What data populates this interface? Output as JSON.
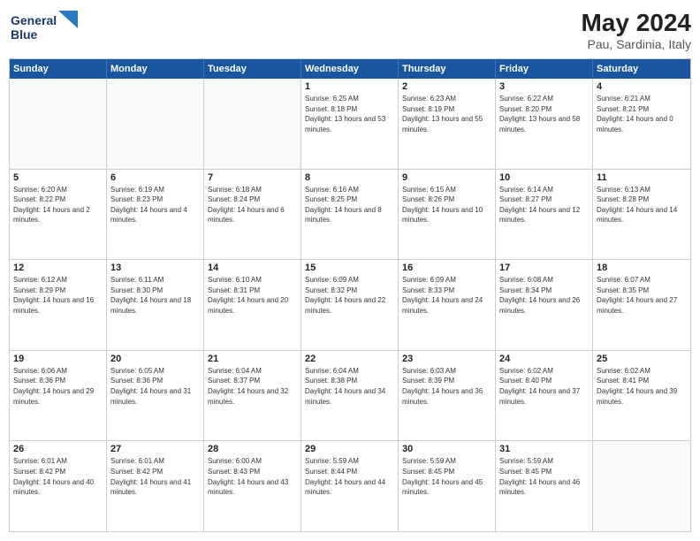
{
  "header": {
    "logo_line1": "General",
    "logo_line2": "Blue",
    "month_title": "May 2024",
    "location": "Pau, Sardinia, Italy"
  },
  "weekdays": [
    "Sunday",
    "Monday",
    "Tuesday",
    "Wednesday",
    "Thursday",
    "Friday",
    "Saturday"
  ],
  "weeks": [
    [
      {
        "day": "",
        "empty": true
      },
      {
        "day": "",
        "empty": true
      },
      {
        "day": "",
        "empty": true
      },
      {
        "day": "1",
        "sunrise": "Sunrise: 6:25 AM",
        "sunset": "Sunset: 8:18 PM",
        "daylight": "Daylight: 13 hours and 53 minutes."
      },
      {
        "day": "2",
        "sunrise": "Sunrise: 6:23 AM",
        "sunset": "Sunset: 8:19 PM",
        "daylight": "Daylight: 13 hours and 55 minutes."
      },
      {
        "day": "3",
        "sunrise": "Sunrise: 6:22 AM",
        "sunset": "Sunset: 8:20 PM",
        "daylight": "Daylight: 13 hours and 58 minutes."
      },
      {
        "day": "4",
        "sunrise": "Sunrise: 6:21 AM",
        "sunset": "Sunset: 8:21 PM",
        "daylight": "Daylight: 14 hours and 0 minutes."
      }
    ],
    [
      {
        "day": "5",
        "sunrise": "Sunrise: 6:20 AM",
        "sunset": "Sunset: 8:22 PM",
        "daylight": "Daylight: 14 hours and 2 minutes."
      },
      {
        "day": "6",
        "sunrise": "Sunrise: 6:19 AM",
        "sunset": "Sunset: 8:23 PM",
        "daylight": "Daylight: 14 hours and 4 minutes."
      },
      {
        "day": "7",
        "sunrise": "Sunrise: 6:18 AM",
        "sunset": "Sunset: 8:24 PM",
        "daylight": "Daylight: 14 hours and 6 minutes."
      },
      {
        "day": "8",
        "sunrise": "Sunrise: 6:16 AM",
        "sunset": "Sunset: 8:25 PM",
        "daylight": "Daylight: 14 hours and 8 minutes."
      },
      {
        "day": "9",
        "sunrise": "Sunrise: 6:15 AM",
        "sunset": "Sunset: 8:26 PM",
        "daylight": "Daylight: 14 hours and 10 minutes."
      },
      {
        "day": "10",
        "sunrise": "Sunrise: 6:14 AM",
        "sunset": "Sunset: 8:27 PM",
        "daylight": "Daylight: 14 hours and 12 minutes."
      },
      {
        "day": "11",
        "sunrise": "Sunrise: 6:13 AM",
        "sunset": "Sunset: 8:28 PM",
        "daylight": "Daylight: 14 hours and 14 minutes."
      }
    ],
    [
      {
        "day": "12",
        "sunrise": "Sunrise: 6:12 AM",
        "sunset": "Sunset: 8:29 PM",
        "daylight": "Daylight: 14 hours and 16 minutes."
      },
      {
        "day": "13",
        "sunrise": "Sunrise: 6:11 AM",
        "sunset": "Sunset: 8:30 PM",
        "daylight": "Daylight: 14 hours and 18 minutes."
      },
      {
        "day": "14",
        "sunrise": "Sunrise: 6:10 AM",
        "sunset": "Sunset: 8:31 PM",
        "daylight": "Daylight: 14 hours and 20 minutes."
      },
      {
        "day": "15",
        "sunrise": "Sunrise: 6:09 AM",
        "sunset": "Sunset: 8:32 PM",
        "daylight": "Daylight: 14 hours and 22 minutes."
      },
      {
        "day": "16",
        "sunrise": "Sunrise: 6:09 AM",
        "sunset": "Sunset: 8:33 PM",
        "daylight": "Daylight: 14 hours and 24 minutes."
      },
      {
        "day": "17",
        "sunrise": "Sunrise: 6:08 AM",
        "sunset": "Sunset: 8:34 PM",
        "daylight": "Daylight: 14 hours and 26 minutes."
      },
      {
        "day": "18",
        "sunrise": "Sunrise: 6:07 AM",
        "sunset": "Sunset: 8:35 PM",
        "daylight": "Daylight: 14 hours and 27 minutes."
      }
    ],
    [
      {
        "day": "19",
        "sunrise": "Sunrise: 6:06 AM",
        "sunset": "Sunset: 8:36 PM",
        "daylight": "Daylight: 14 hours and 29 minutes."
      },
      {
        "day": "20",
        "sunrise": "Sunrise: 6:05 AM",
        "sunset": "Sunset: 8:36 PM",
        "daylight": "Daylight: 14 hours and 31 minutes."
      },
      {
        "day": "21",
        "sunrise": "Sunrise: 6:04 AM",
        "sunset": "Sunset: 8:37 PM",
        "daylight": "Daylight: 14 hours and 32 minutes."
      },
      {
        "day": "22",
        "sunrise": "Sunrise: 6:04 AM",
        "sunset": "Sunset: 8:38 PM",
        "daylight": "Daylight: 14 hours and 34 minutes."
      },
      {
        "day": "23",
        "sunrise": "Sunrise: 6:03 AM",
        "sunset": "Sunset: 8:39 PM",
        "daylight": "Daylight: 14 hours and 36 minutes."
      },
      {
        "day": "24",
        "sunrise": "Sunrise: 6:02 AM",
        "sunset": "Sunset: 8:40 PM",
        "daylight": "Daylight: 14 hours and 37 minutes."
      },
      {
        "day": "25",
        "sunrise": "Sunrise: 6:02 AM",
        "sunset": "Sunset: 8:41 PM",
        "daylight": "Daylight: 14 hours and 39 minutes."
      }
    ],
    [
      {
        "day": "26",
        "sunrise": "Sunrise: 6:01 AM",
        "sunset": "Sunset: 8:42 PM",
        "daylight": "Daylight: 14 hours and 40 minutes."
      },
      {
        "day": "27",
        "sunrise": "Sunrise: 6:01 AM",
        "sunset": "Sunset: 8:42 PM",
        "daylight": "Daylight: 14 hours and 41 minutes."
      },
      {
        "day": "28",
        "sunrise": "Sunrise: 6:00 AM",
        "sunset": "Sunset: 8:43 PM",
        "daylight": "Daylight: 14 hours and 43 minutes."
      },
      {
        "day": "29",
        "sunrise": "Sunrise: 5:59 AM",
        "sunset": "Sunset: 8:44 PM",
        "daylight": "Daylight: 14 hours and 44 minutes."
      },
      {
        "day": "30",
        "sunrise": "Sunrise: 5:59 AM",
        "sunset": "Sunset: 8:45 PM",
        "daylight": "Daylight: 14 hours and 45 minutes."
      },
      {
        "day": "31",
        "sunrise": "Sunrise: 5:59 AM",
        "sunset": "Sunset: 8:45 PM",
        "daylight": "Daylight: 14 hours and 46 minutes."
      },
      {
        "day": "",
        "empty": true
      }
    ]
  ]
}
